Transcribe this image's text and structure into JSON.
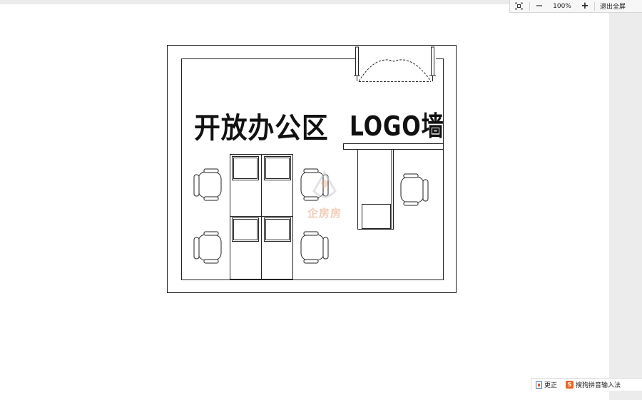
{
  "toolbar": {
    "fit_icon": "fit-screen-icon",
    "zoom_out_label": "−",
    "zoom_level": "100%",
    "zoom_in_label": "+",
    "exit_fullscreen_label": "退出全屏"
  },
  "floorplan": {
    "open_office_label": "开放办公区",
    "logo_wall_label": "LOGO墙",
    "watermark_text": "企房房"
  },
  "status_tray": {
    "correct_label": "更正",
    "ime_label": "搜狗拼音输入法"
  },
  "colors": {
    "accent_watermark": "#e8a37e",
    "ime_brand": "#f0641e",
    "plan_line": "#222222"
  }
}
